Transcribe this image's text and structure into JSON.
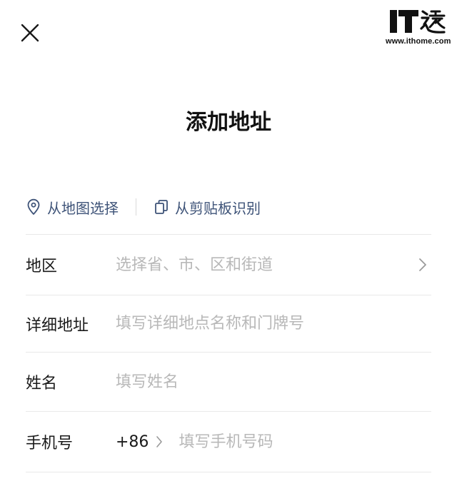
{
  "watermark": {
    "logo_text": "IT之家",
    "url": "www.ithome.com"
  },
  "header": {
    "close_icon": "close-icon",
    "title": "添加地址"
  },
  "quick_actions": {
    "map_select": {
      "icon": "location-pin-icon",
      "label": "从地图选择"
    },
    "clipboard": {
      "icon": "copy-icon",
      "label": "从剪贴板识别"
    }
  },
  "form": {
    "region": {
      "label": "地区",
      "placeholder": "选择省、市、区和街道",
      "value": "",
      "chevron_icon": "chevron-right-icon"
    },
    "detail_address": {
      "label": "详细地址",
      "placeholder": "填写详细地点名称和门牌号",
      "value": ""
    },
    "name": {
      "label": "姓名",
      "placeholder": "填写姓名",
      "value": ""
    },
    "phone": {
      "label": "手机号",
      "country_code": "+86",
      "country_code_chevron_icon": "chevron-right-icon",
      "placeholder": "填写手机号码",
      "value": ""
    }
  },
  "colors": {
    "accent_link": "#3e5378",
    "placeholder": "#b8b8b8",
    "divider": "#e9e9e9",
    "text": "#1a1a1a"
  }
}
